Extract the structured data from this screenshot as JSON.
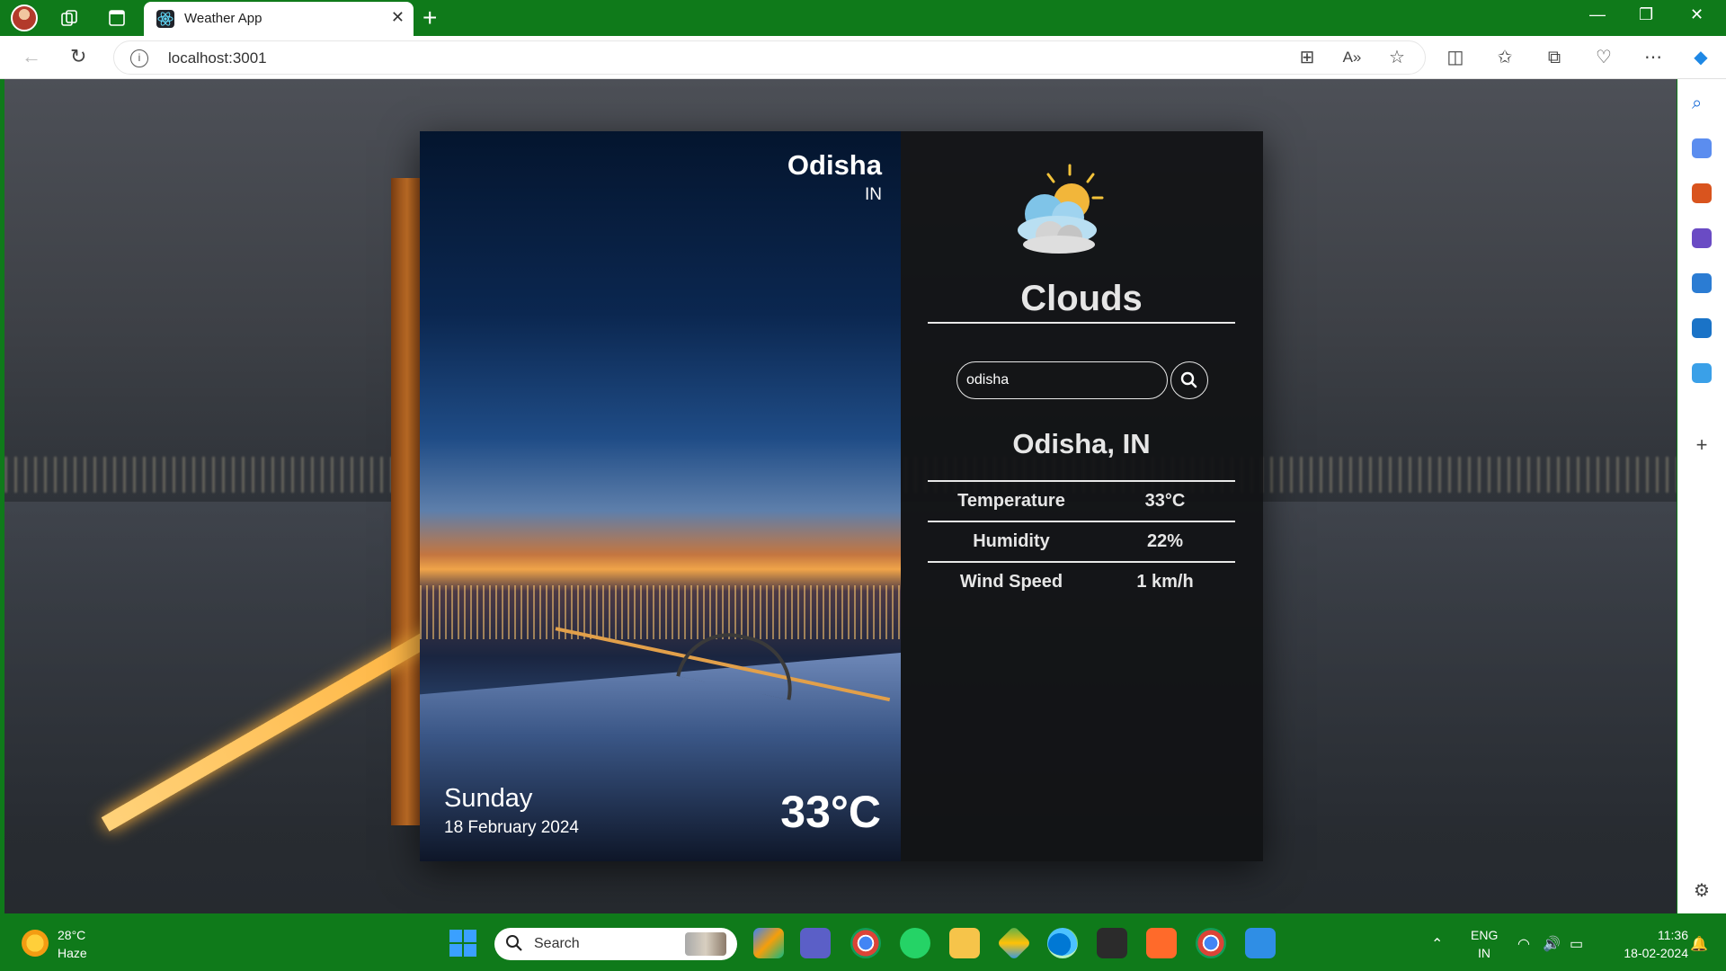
{
  "browser": {
    "tab_title": "Weather App",
    "url": "localhost:3001"
  },
  "weather_card": {
    "city": "Odisha",
    "country": "IN",
    "day": "Sunday",
    "date": "18 February 2024",
    "temperature_big": "33°C",
    "condition": "Clouds",
    "search": {
      "value": "odisha"
    },
    "location_title": "Odisha, IN",
    "details": [
      {
        "label": "Temperature",
        "value": "33°C"
      },
      {
        "label": "Humidity",
        "value": "22%"
      },
      {
        "label": "Wind Speed",
        "value": "1 km/h"
      }
    ]
  },
  "taskbar": {
    "weather_temp": "28°C",
    "weather_condition": "Haze",
    "search_label": "Search",
    "language": "ENG",
    "region": "IN",
    "time": "11:36",
    "date": "18-02-2024"
  },
  "colors": {
    "chrome_green": "#0f7a1a",
    "card_dark": "#111214",
    "text_light": "#e6e6e6"
  }
}
